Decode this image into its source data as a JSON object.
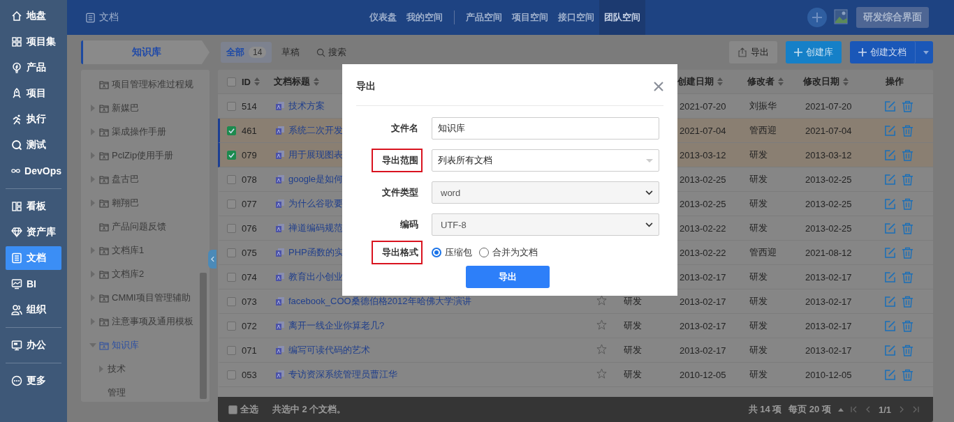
{
  "sidebar": {
    "groups": [
      {
        "items": [
          {
            "label": "地盘",
            "selected": false
          },
          {
            "label": "项目集",
            "selected": false
          },
          {
            "label": "产品",
            "selected": false
          },
          {
            "label": "项目",
            "selected": false
          },
          {
            "label": "执行",
            "selected": false
          },
          {
            "label": "测试",
            "selected": false
          },
          {
            "label": "DevOps",
            "selected": false
          }
        ]
      },
      {
        "items": [
          {
            "label": "看板",
            "selected": false
          },
          {
            "label": "资产库",
            "selected": false
          },
          {
            "label": "文档",
            "selected": true
          },
          {
            "label": "BI",
            "selected": false
          },
          {
            "label": "组织",
            "selected": false
          }
        ]
      },
      {
        "items": [
          {
            "label": "办公",
            "selected": false
          }
        ]
      },
      {
        "items": [
          {
            "label": "更多",
            "selected": false
          }
        ]
      }
    ]
  },
  "header": {
    "title": "文档",
    "nav": [
      {
        "items": [
          {
            "label": "仪表盘",
            "selected": false
          },
          {
            "label": "我的空间",
            "selected": false
          }
        ]
      },
      {
        "items": [
          {
            "label": "产品空间",
            "selected": false
          },
          {
            "label": "项目空间",
            "selected": false
          },
          {
            "label": "接口空间",
            "selected": false
          },
          {
            "label": "团队空间",
            "selected": true
          }
        ]
      }
    ],
    "switch_button": "研发综合界面"
  },
  "toolbar": {
    "library": "知识库",
    "tabs": [
      {
        "label": "全部",
        "count": "14",
        "selected": true
      },
      {
        "label": "草稿",
        "selected": false
      }
    ],
    "search": "搜索",
    "export_button": "导出",
    "create_library_button": "创建库",
    "create_doc_button": "创建文档"
  },
  "tree": [
    {
      "label": "项目管理标准过程规",
      "kind": "folder",
      "expandable": false,
      "selected": false
    },
    {
      "label": "新媒巴",
      "kind": "folder",
      "expandable": true,
      "expanded": false,
      "selected": false
    },
    {
      "label": "渠成操作手册",
      "kind": "folder",
      "expandable": true,
      "expanded": false,
      "selected": false
    },
    {
      "label": "PclZip使用手册",
      "kind": "folder",
      "expandable": true,
      "expanded": false,
      "selected": false
    },
    {
      "label": "盘古巴",
      "kind": "folder",
      "expandable": true,
      "expanded": false,
      "selected": false
    },
    {
      "label": "翱翔巴",
      "kind": "folder",
      "expandable": true,
      "expanded": false,
      "selected": false
    },
    {
      "label": "产品问题反馈",
      "kind": "folder",
      "expandable": false,
      "selected": false
    },
    {
      "label": "文档库1",
      "kind": "folder",
      "expandable": true,
      "expanded": false,
      "selected": false
    },
    {
      "label": "文档库2",
      "kind": "folder",
      "expandable": true,
      "expanded": false,
      "selected": false
    },
    {
      "label": "CMMI项目管理辅助",
      "kind": "folder",
      "expandable": true,
      "expanded": false,
      "selected": false
    },
    {
      "label": "注意事项及通用模板",
      "kind": "folder",
      "expandable": true,
      "expanded": false,
      "selected": false
    },
    {
      "label": "知识库",
      "kind": "folder",
      "expandable": true,
      "expanded": true,
      "selected": true,
      "children": [
        {
          "label": "技术",
          "expandable": true,
          "expanded": false,
          "selected": false
        },
        {
          "label": "管理",
          "expandable": false,
          "selected": false
        }
      ]
    }
  ],
  "table": {
    "header_checked": false,
    "columns": [
      "ID",
      "文档标题",
      "创建日期",
      "修改者",
      "修改日期",
      "操作"
    ],
    "rows": [
      {
        "checked": false,
        "id": "514",
        "title": "技术方案",
        "created": "2021-07-20",
        "modifier": "刘振华",
        "modified": "2021-07-20"
      },
      {
        "checked": true,
        "id": "461",
        "title": "系统二次开发",
        "created": "2021-07-04",
        "modifier": "管西迎",
        "modified": "2021-07-04"
      },
      {
        "checked": true,
        "id": "079",
        "title": "用于展现图表",
        "created": "2013-03-12",
        "modifier": "研发",
        "modified": "2013-03-12"
      },
      {
        "checked": false,
        "id": "078",
        "title": "google是如何",
        "created": "2013-02-25",
        "modifier": "研发",
        "modified": "2013-02-25"
      },
      {
        "checked": false,
        "id": "077",
        "title": "为什么谷歌要",
        "created": "2013-02-25",
        "modifier": "研发",
        "modified": "2013-02-25"
      },
      {
        "checked": false,
        "id": "076",
        "title": "禅道编码规范",
        "created": "2013-02-22",
        "modifier": "研发",
        "modified": "2013-02-25"
      },
      {
        "checked": false,
        "id": "075",
        "title": "PHP函数的实",
        "created": "2013-02-22",
        "modifier": "管西迎",
        "modified": "2021-08-12"
      },
      {
        "checked": false,
        "id": "074",
        "title": "教育出小创业",
        "created": "2013-02-17",
        "modifier": "研发",
        "modified": "2013-02-17"
      },
      {
        "checked": false,
        "id": "073",
        "title": "facebook_COO桑德伯格2012年哈佛大学演讲",
        "author": "研发",
        "created": "2013-02-17",
        "modifier": "研发",
        "modified": "2013-02-17"
      },
      {
        "checked": false,
        "id": "072",
        "title": "离开一线企业你算老几?",
        "author": "研发",
        "created": "2013-02-17",
        "modifier": "研发",
        "modified": "2013-02-17"
      },
      {
        "checked": false,
        "id": "071",
        "title": "编写可读代码的艺术",
        "author": "研发",
        "created": "2013-02-17",
        "modifier": "研发",
        "modified": "2013-02-17"
      },
      {
        "checked": false,
        "id": "053",
        "title": "专访资深系统管理员曹江华",
        "author": "研发",
        "created": "2010-12-05",
        "modifier": "研发",
        "modified": "2010-12-05"
      }
    ]
  },
  "footer": {
    "select_all": {
      "label": "全选",
      "checked": false
    },
    "summary": "共选中 2 个文档。",
    "total": "共 14 项",
    "page_size": "每页 20 项",
    "page": "1/1"
  },
  "dialog": {
    "title": "导出",
    "fields": [
      {
        "kind": "input",
        "label": "文件名",
        "value": "知识库",
        "highlighted": false
      },
      {
        "kind": "combo",
        "label": "导出范围",
        "value": "列表所有文档",
        "highlighted": true
      },
      {
        "kind": "select",
        "label": "文件类型",
        "value": "word",
        "highlighted": false
      },
      {
        "kind": "select",
        "label": "编码",
        "value": "UTF-8",
        "highlighted": false
      },
      {
        "kind": "radio",
        "label": "导出格式",
        "highlighted": true,
        "options": [
          {
            "label": "压缩包",
            "selected": true
          },
          {
            "label": "合并为文档",
            "selected": false
          }
        ]
      }
    ],
    "submit": "导出"
  }
}
